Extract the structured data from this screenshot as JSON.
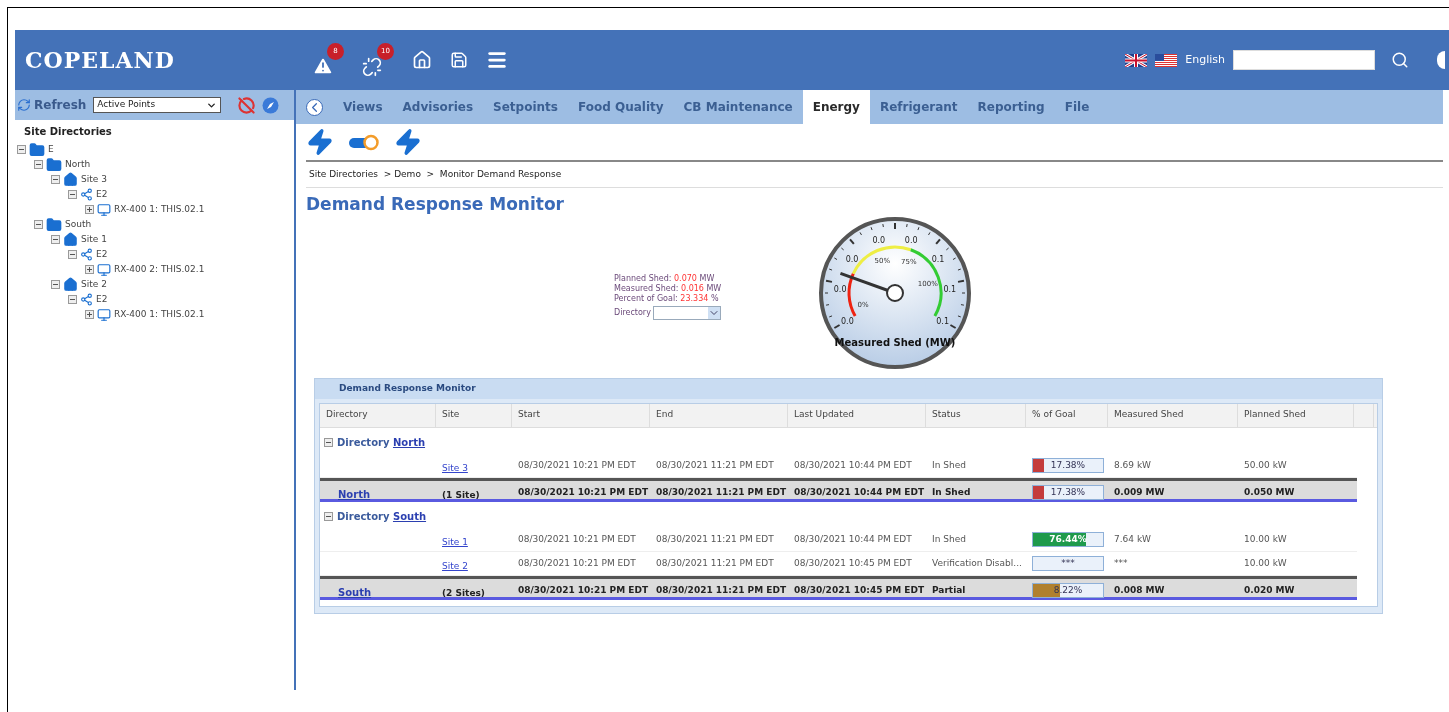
{
  "logo": "COPELAND",
  "header": {
    "badges": [
      {
        "kind": "alarm",
        "count": "8"
      },
      {
        "kind": "link",
        "count": "10"
      }
    ],
    "language": "English"
  },
  "sidebar": {
    "refresh": "Refresh",
    "filter": "Active Points",
    "heading": "Site Directories",
    "tree": [
      {
        "label": "E",
        "kind": "folder",
        "expanded": true,
        "children": [
          {
            "label": "North",
            "kind": "folder",
            "expanded": true,
            "children": [
              {
                "label": "Site 3",
                "kind": "site",
                "expanded": true,
                "children": [
                  {
                    "label": "E2",
                    "kind": "network",
                    "expanded": true,
                    "children": [
                      {
                        "label": "RX-400 1: THIS.02.1",
                        "kind": "device",
                        "expanded": false
                      }
                    ]
                  }
                ]
              }
            ]
          },
          {
            "label": "South",
            "kind": "folder",
            "expanded": true,
            "children": [
              {
                "label": "Site 1",
                "kind": "site",
                "expanded": true,
                "children": [
                  {
                    "label": "E2",
                    "kind": "network",
                    "expanded": true,
                    "children": [
                      {
                        "label": "RX-400 2: THIS.02.1",
                        "kind": "device",
                        "expanded": false
                      }
                    ]
                  }
                ]
              },
              {
                "label": "Site 2",
                "kind": "site",
                "expanded": true,
                "children": [
                  {
                    "label": "E2",
                    "kind": "network",
                    "expanded": true,
                    "children": [
                      {
                        "label": "RX-400 1: THIS.02.1",
                        "kind": "device",
                        "expanded": false
                      }
                    ]
                  }
                ]
              }
            ]
          }
        ]
      }
    ]
  },
  "tabs": [
    {
      "label": "Views",
      "selected": false
    },
    {
      "label": "Advisories",
      "selected": false
    },
    {
      "label": "Setpoints",
      "selected": false
    },
    {
      "label": "Food Quality",
      "selected": false
    },
    {
      "label": "CB Maintenance",
      "selected": false
    },
    {
      "label": "Energy",
      "selected": true
    },
    {
      "label": "Refrigerant",
      "selected": false
    },
    {
      "label": "Reporting",
      "selected": false
    },
    {
      "label": "File",
      "selected": false
    }
  ],
  "breadcrumb": "Site Directories  > Demo  >  Monitor Demand Response",
  "title": "Demand Response Monitor",
  "summary": [
    {
      "label": "Planned Shed:",
      "value": "0.070",
      "unit": "MW"
    },
    {
      "label": "Measured Shed:",
      "value": "0.016",
      "unit": "MW"
    },
    {
      "label": "Percent of Goal:",
      "value": "23.334",
      "unit": "%"
    }
  ],
  "directory_label": "Directory",
  "gauge": {
    "title": "Measured Shed (MW)",
    "level": 0.23,
    "scale": [
      "0.0",
      "0.0",
      "0.0",
      "0.0",
      "0.0",
      "0.1",
      "0.1",
      "0.1"
    ],
    "percent_labels": [
      "0%",
      "50%",
      "75%",
      "100%"
    ]
  },
  "table": {
    "title": "Demand Response Monitor",
    "columns": [
      "Directory",
      "Site",
      "Start",
      "End",
      "Last Updated",
      "Status",
      "% of Goal",
      "Measured Shed",
      "Planned Shed"
    ],
    "groups": [
      {
        "label": "Directory",
        "name": "North",
        "rows": [
          {
            "site": "Site 3",
            "start": "08/30/2021 10:21 PM EDT",
            "end": "08/30/2021 11:21 PM EDT",
            "updated": "08/30/2021 10:44 PM EDT",
            "status": "In Shed",
            "goal": {
              "text": "17.38%",
              "level": 0.15,
              "color": "#c43c3c"
            },
            "measured": "8.69 kW",
            "planned": "50.00 kW"
          }
        ],
        "total": {
          "directory": "North",
          "site": "(1 Site)",
          "start": "08/30/2021 10:21 PM EDT",
          "end": "08/30/2021 11:21 PM EDT",
          "updated": "08/30/2021 10:44 PM EDT",
          "status": "In Shed",
          "goal": {
            "text": "17.38%",
            "level": 0.15,
            "color": "#c43c3c"
          },
          "measured": "0.009 MW",
          "planned": "0.050 MW"
        }
      },
      {
        "label": "Directory",
        "name": "South",
        "rows": [
          {
            "site": "Site 1",
            "start": "08/30/2021 10:21 PM EDT",
            "end": "08/30/2021 11:21 PM EDT",
            "updated": "08/30/2021 10:44 PM EDT",
            "status": "In Shed",
            "goal": {
              "text": "76.44%",
              "level": 0.76,
              "color": "#1e9a4c"
            },
            "measured": "7.64 kW",
            "planned": "10.00 kW"
          },
          {
            "site": "Site 2",
            "start": "08/30/2021 10:21 PM EDT",
            "end": "08/30/2021 11:21 PM EDT",
            "updated": "08/30/2021 10:45 PM EDT",
            "status": "Verification Disabl...",
            "goal": {
              "text": "***"
            },
            "measured": "***",
            "planned": "10.00 kW"
          }
        ],
        "total": {
          "directory": "South",
          "site": "(2 Sites)",
          "start": "08/30/2021 10:21 PM EDT",
          "end": "08/30/2021 11:21 PM EDT",
          "updated": "08/30/2021 10:45 PM EDT",
          "status": "Partial",
          "goal": {
            "text": "8.22%",
            "level": 0.38,
            "color": "#b0802e"
          },
          "measured": "0.008 MW",
          "planned": "0.020 MW"
        }
      }
    ]
  }
}
